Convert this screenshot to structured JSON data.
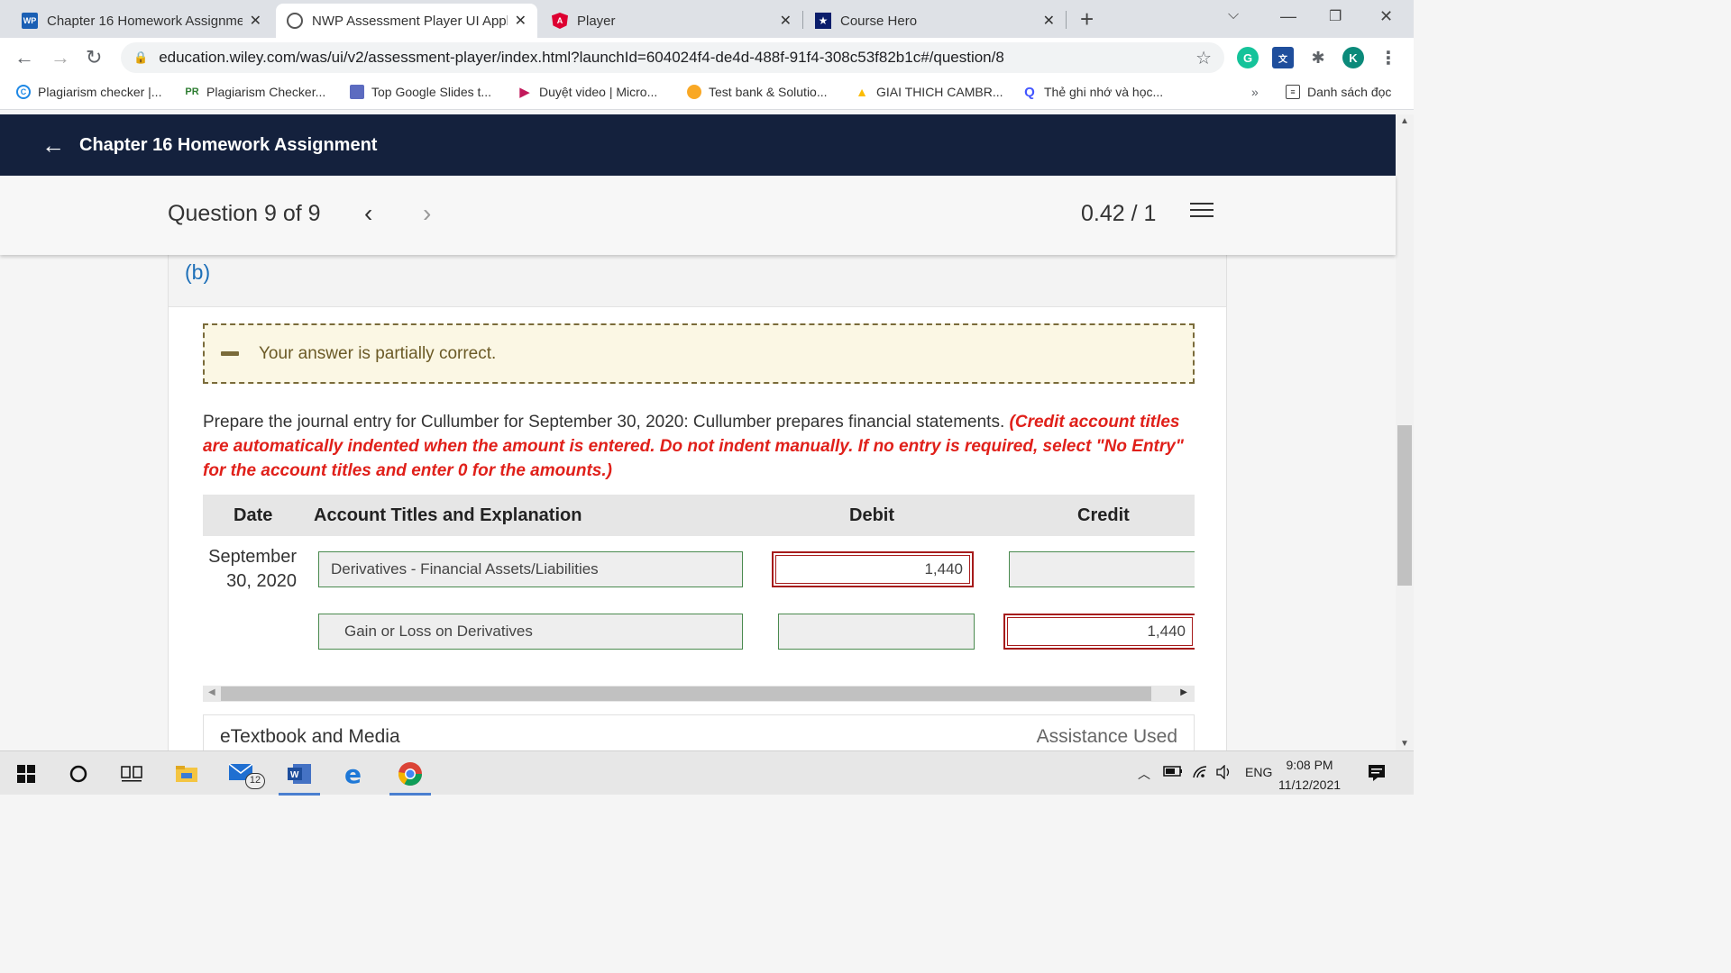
{
  "browser": {
    "tabs": [
      {
        "favicon": "WP",
        "title": "Chapter 16 Homework Assignme",
        "active": false
      },
      {
        "favicon": "globe",
        "title": "NWP Assessment Player UI Appli",
        "active": true
      },
      {
        "favicon": "A",
        "title": "Player",
        "active": false
      },
      {
        "favicon": "★",
        "title": "Course Hero",
        "active": false
      }
    ],
    "url": "education.wiley.com/was/ui/v2/assessment-player/index.html?launchId=604024f4-de4d-488f-91f4-308c53f82b1c#/question/8",
    "profile_initial": "K",
    "bookmarks": [
      "Plagiarism checker |...",
      "Plagiarism Checker...",
      "Top Google Slides t...",
      "Duyệt video | Micro...",
      "Test bank & Solutio...",
      "GIAI THICH CAMBR...",
      "Thẻ ghi nhớ và học..."
    ],
    "bookmarks_overflow": "»",
    "reading_list": "Danh sách đọc"
  },
  "app": {
    "header_title": "Chapter 16 Homework Assignment",
    "question_label": "Question 9 of 9",
    "score": "0.42 / 1",
    "part_label": "(b)",
    "feedback": "Your answer is partially correct.",
    "instruction_main": "Prepare the journal entry for Cullumber for September 30, 2020: Cullumber prepares financial statements. ",
    "instruction_red": "(Credit account titles are automatically indented when the amount is entered. Do not indent manually. If no entry is required, select \"No Entry\" for the account titles and enter 0 for the amounts.)",
    "table": {
      "headers": {
        "date": "Date",
        "account": "Account Titles and Explanation",
        "debit": "Debit",
        "credit": "Credit"
      },
      "date_line1": "September",
      "date_line2": "30, 2020",
      "rows": [
        {
          "account": "Derivatives - Financial Assets/Liabilities",
          "debit": "1,440",
          "credit": ""
        },
        {
          "account": "Gain or Loss on Derivatives",
          "debit": "",
          "credit": "1,440"
        }
      ]
    },
    "etextbook": "eTextbook and Media",
    "assistance": "Assistance Used"
  },
  "taskbar": {
    "mail_badge": "12",
    "language": "ENG",
    "time": "9:08 PM",
    "date": "11/12/2021"
  },
  "colors": {
    "header_bg": "#14213d",
    "part_label": "#1d6fb8",
    "error_border": "#a61b1b",
    "instruction_red": "#e0201a",
    "field_border": "#4a8a4f"
  }
}
